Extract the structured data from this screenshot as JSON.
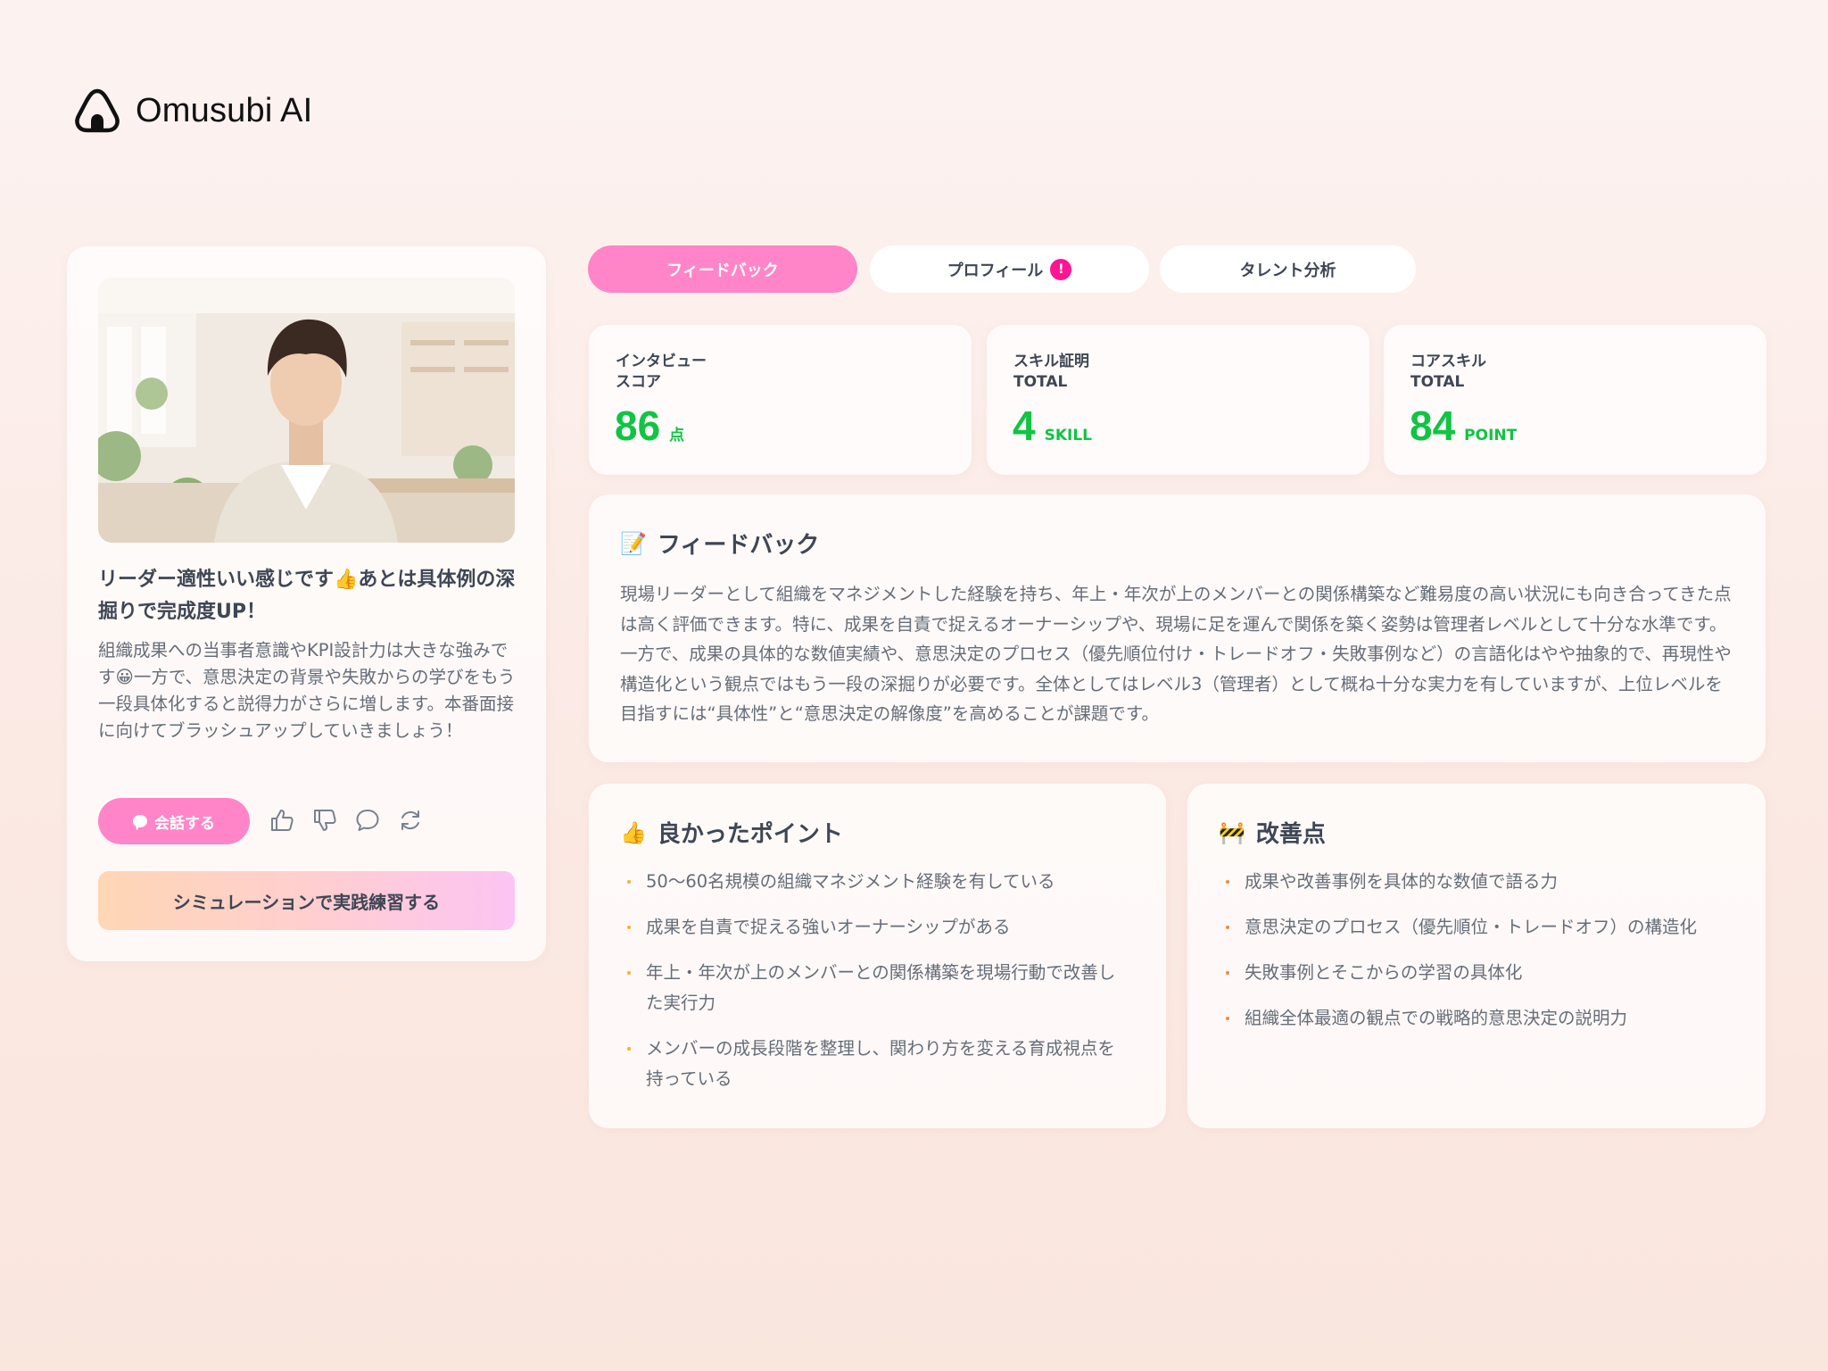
{
  "app": {
    "name": "Omusubi AI"
  },
  "profile_card": {
    "headline": "リーダー適性いい感じです👍あとは具体例の深掘りで完成度UP！",
    "message": "組織成果への当事者意識やKPI設計力は大きな強みです😀一方で、意思決定の背景や失敗からの学びをもう一段具体化すると説得力がさらに増します。本番面接に向けてブラッシュアップしていきましょう！",
    "chat_button": "会話する",
    "action_icons": [
      "thumbs-up-icon",
      "thumbs-down-icon",
      "comment-icon",
      "refresh-icon"
    ],
    "simulation_button": "シミュレーションで実践練習する"
  },
  "tabs": [
    {
      "label": "フィードバック",
      "active": true
    },
    {
      "label": "プロフィール",
      "badge": "!"
    },
    {
      "label": "タレント分析"
    }
  ],
  "stats": [
    {
      "label_line1": "インタビュー",
      "label_line2": "スコア",
      "value": "86",
      "unit": "点"
    },
    {
      "label_line1": "スキル証明",
      "label_line2": "TOTAL",
      "value": "4",
      "unit": "SKILL"
    },
    {
      "label_line1": "コアスキル",
      "label_line2": "TOTAL",
      "value": "84",
      "unit": "POINT"
    }
  ],
  "feedback": {
    "emoji": "📝",
    "title": "フィードバック",
    "body": "現場リーダーとして組織をマネジメントした経験を持ち、年上・年次が上のメンバーとの関係構築など難易度の高い状況にも向き合ってきた点は高く評価できます。特に、成果を自責で捉えるオーナーシップや、現場に足を運んで関係を築く姿勢は管理者レベルとして十分な水準です。一方で、成果の具体的な数値実績や、意思決定のプロセス（優先順位付け・トレードオフ・失敗事例など）の言語化はやや抽象的で、再現性や構造化という観点ではもう一段の深掘りが必要です。全体としてはレベル3（管理者）として概ね十分な実力を有していますが、上位レベルを目指すには“具体性”と“意思決定の解像度”を高めることが課題です。"
  },
  "good_points": {
    "emoji": "👍",
    "title": "良かったポイント",
    "items": [
      "50〜60名規模の組織マネジメント経験を有している",
      "成果を自責で捉える強いオーナーシップがある",
      "年上・年次が上のメンバーとの関係構築を現場行動で改善した実行力",
      "メンバーの成長段階を整理し、関わり方を変える育成視点を持っている"
    ]
  },
  "improvements": {
    "emoji": "🚧",
    "title": "改善点",
    "items": [
      "成果や改善事例を具体的な数値で語る力",
      "意思決定のプロセス（優先順位・トレードオフ）の構造化",
      "失敗事例とそこからの学習の具体化",
      "組織全体最適の観点での戦略的意思決定の説明力"
    ]
  },
  "colors": {
    "accent_pink": "#ff85c8",
    "badge_pink": "#ff1493",
    "score_green": "#11c444",
    "bullet_yellow": "#f4b326",
    "bullet_orange": "#f28a3c"
  }
}
